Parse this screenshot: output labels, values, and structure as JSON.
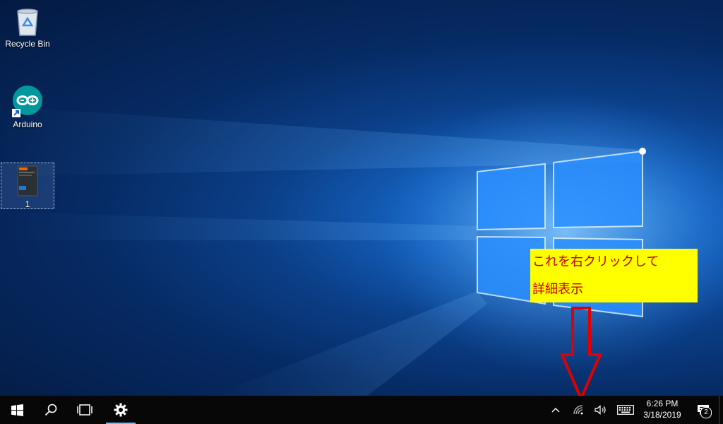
{
  "desktop": {
    "icons": [
      {
        "label": "Recycle Bin",
        "icon": "recycle-bin-icon"
      },
      {
        "label": "Arduino",
        "icon": "arduino-icon"
      },
      {
        "label": "1",
        "icon": "screenshot-file-icon"
      }
    ]
  },
  "annotation": {
    "line1": "これを右クリックして",
    "line2": "詳細表示",
    "background_color": "#ffff00",
    "text_color": "#c00000",
    "arrow_color": "#e00000"
  },
  "taskbar": {
    "start_icon": "windows-start-icon",
    "search_icon": "search-icon",
    "taskview_icon": "task-view-icon",
    "settings_icon": "gear-icon",
    "tray": {
      "chevron_icon": "chevron-up-icon",
      "network_icon": "wifi-icon",
      "volume_icon": "speaker-icon",
      "keyboard_icon": "keyboard-icon"
    },
    "clock": {
      "time": "6:26 PM",
      "date": "3/18/2019"
    },
    "action_center": {
      "icon": "notification-icon",
      "count": "2"
    }
  },
  "colors": {
    "taskbar_bg": "#070707",
    "accent": "#76b9ed"
  }
}
